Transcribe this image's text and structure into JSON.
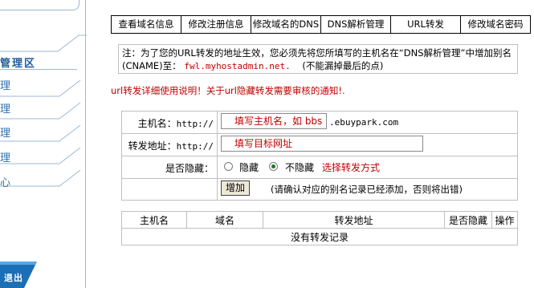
{
  "sidebar": {
    "zone_title": "管理区",
    "items": [
      "理",
      "理",
      "理",
      "理",
      "心"
    ],
    "logout_label": "退出"
  },
  "tabs": [
    "查看域名信息",
    "修改注册信息",
    "修改域名的DNS",
    "DNS解析管理",
    "URL转发",
    "修改域名密码"
  ],
  "notice": {
    "text": "注：为了您的URL转发的地址生效，您必须先将您所填写的主机名在“DNS解析管理”中增加别名(CNAME)至：",
    "host": "fwl.myhostadmin.net.",
    "tail": "(不能漏掉最后的点)"
  },
  "help_link": "url转发详细使用说明！关于url隐藏转发需要审核的通知!.",
  "form": {
    "host_label": "主机名：",
    "host_prefix": "http://",
    "host_value": "填写主机名，如 bbs",
    "domain_suffix": ".ebuypark.com",
    "target_label": "转发地址：",
    "target_prefix": "http://",
    "target_value": "填写目标网址",
    "hidden_label": "是否隐藏：",
    "hidden_options": [
      "隐藏",
      "不隐藏"
    ],
    "hidden_selected": 1,
    "hidden_hint": "选择转发方式",
    "add_button": "增加",
    "add_note": "(请确认对应的别名记录已经添加，否则将出错)"
  },
  "records": {
    "headers": [
      "主机名",
      "域名",
      "转发地址",
      "是否隐藏",
      "操作"
    ],
    "empty_text": "没有转发记录"
  }
}
